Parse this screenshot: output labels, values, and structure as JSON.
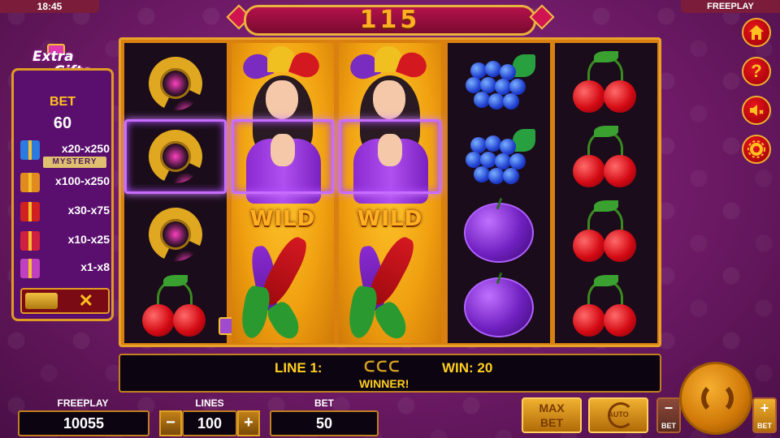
{
  "status": {
    "clock": "18:45",
    "mode": "FREEPLAY"
  },
  "win_display": "115",
  "side_buttons": {
    "home_icon": "home-icon",
    "help_icon": "help-icon",
    "help_glyph": "?",
    "sound_icon": "sound-muted-icon",
    "settings_icon": "gear-icon"
  },
  "extra_gifts": {
    "logo_line1": "Extra",
    "logo_line2": "Gifts",
    "bet_label": "BET",
    "bet_value": "60",
    "rows": [
      {
        "range": "x20-x250",
        "tag": "MYSTERY",
        "color": "#2a7ae0"
      },
      {
        "range": "x100-x250",
        "color": "#e08a20"
      },
      {
        "range": "x30-x75",
        "color": "#d02020"
      },
      {
        "range": "x10-x25",
        "color": "#d02040"
      },
      {
        "range": "x1-x8",
        "color": "#c040c0"
      }
    ],
    "toggle_close": "✕"
  },
  "reels": [
    {
      "style": "dark",
      "symbols": [
        "horseshoe",
        "horseshoe",
        "horseshoe",
        "cherries"
      ]
    },
    {
      "style": "gold",
      "symbols": [
        "jester-wild"
      ]
    },
    {
      "style": "gold",
      "symbols": [
        "jester-wild"
      ]
    },
    {
      "style": "dark",
      "symbols": [
        "grapes",
        "grapes",
        "plum",
        "plum"
      ]
    },
    {
      "style": "dark",
      "symbols": [
        "cherries",
        "cherries",
        "cherries",
        "cherries"
      ]
    }
  ],
  "wild_label": "WILD",
  "info": {
    "line_label": "LINE 1:",
    "line_symbols": "ᑕᑕᑕ",
    "win_label": "WIN: 20",
    "winner": "WINNER!"
  },
  "controls": {
    "freeplay_label": "FREEPLAY",
    "freeplay_value": "10055",
    "lines_label": "LINES",
    "lines_value": "100",
    "lines_minus": "−",
    "lines_plus": "+",
    "bet_label": "BET",
    "bet_value": "50",
    "maxbet_line1": "MAX",
    "maxbet_line2": "BET",
    "auto_label": "AUTO",
    "bet_minus_label": "BET",
    "bet_plus_label": "BET",
    "bet_minus_sign": "−",
    "bet_plus_sign": "+"
  },
  "colors": {
    "accent_gold": "#e8a22a",
    "background": "#6e1a66",
    "banner": "#b3124a"
  }
}
